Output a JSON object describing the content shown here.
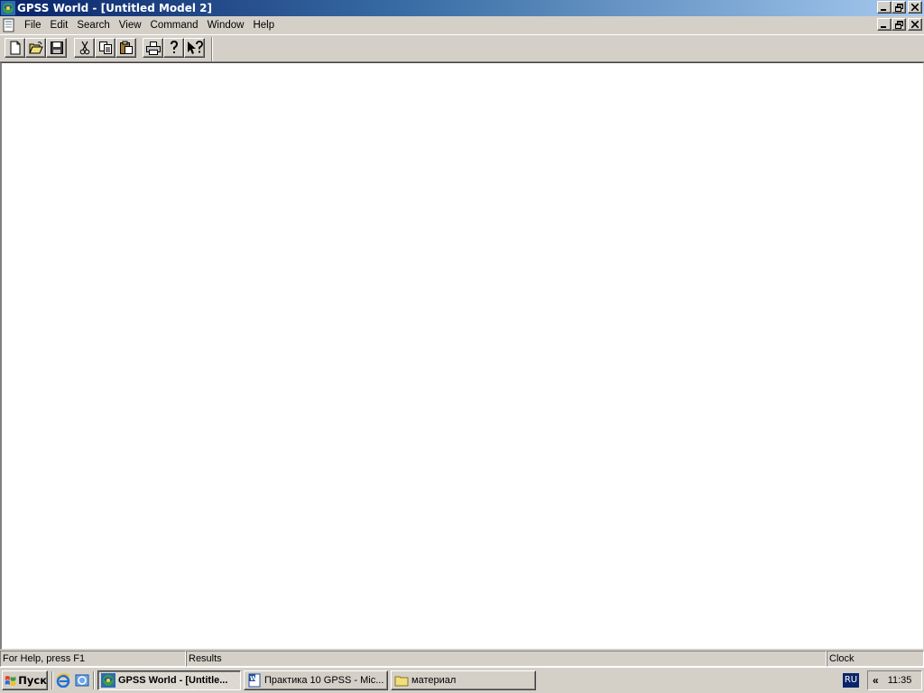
{
  "window": {
    "title": "GPSS World - [Untitled Model 2]",
    "app_icon": "gpss-world-icon"
  },
  "menubar": {
    "items": [
      "File",
      "Edit",
      "Search",
      "View",
      "Command",
      "Window",
      "Help"
    ]
  },
  "toolbar": {
    "buttons": [
      {
        "name": "new-button",
        "icon": "new-document-icon"
      },
      {
        "name": "open-button",
        "icon": "open-folder-icon"
      },
      {
        "name": "save-button",
        "icon": "floppy-disk-icon"
      },
      {
        "name": "cut-button",
        "icon": "scissors-icon"
      },
      {
        "name": "copy-button",
        "icon": "copy-icon"
      },
      {
        "name": "paste-button",
        "icon": "clipboard-icon"
      },
      {
        "name": "print-button",
        "icon": "printer-icon"
      },
      {
        "name": "help-button",
        "icon": "question-mark-icon"
      },
      {
        "name": "context-help-button",
        "icon": "arrow-question-icon"
      }
    ]
  },
  "statusbar": {
    "help_text": "For Help, press F1",
    "results": "Results",
    "clock": "Clock"
  },
  "taskbar": {
    "start_label": "Пуск",
    "tasks": [
      {
        "label": "GPSS World - [Untitle...",
        "active": true
      },
      {
        "label": "Практика 10 GPSS - Mic...",
        "active": false
      },
      {
        "label": "материал",
        "active": false
      }
    ],
    "language": "RU",
    "tray_chevron": "«",
    "time": "11:35"
  }
}
